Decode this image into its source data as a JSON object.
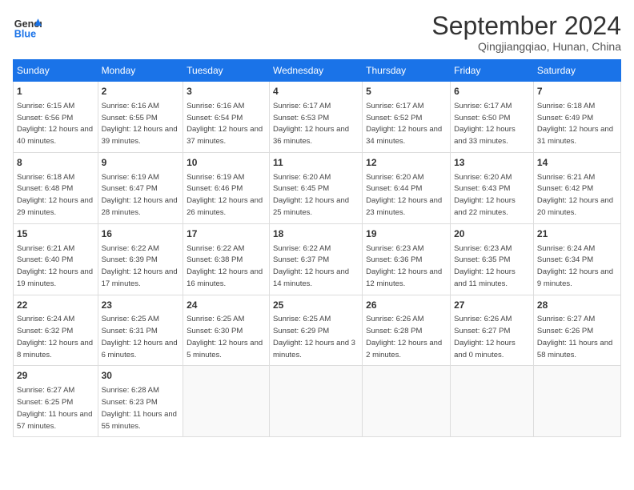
{
  "logo": {
    "line1": "General",
    "line2": "Blue"
  },
  "title": "September 2024",
  "subtitle": "Qingjiangqiao, Hunan, China",
  "days_of_week": [
    "Sunday",
    "Monday",
    "Tuesday",
    "Wednesday",
    "Thursday",
    "Friday",
    "Saturday"
  ],
  "weeks": [
    [
      {
        "day": "1",
        "sunrise": "Sunrise: 6:15 AM",
        "sunset": "Sunset: 6:56 PM",
        "daylight": "Daylight: 12 hours and 40 minutes."
      },
      {
        "day": "2",
        "sunrise": "Sunrise: 6:16 AM",
        "sunset": "Sunset: 6:55 PM",
        "daylight": "Daylight: 12 hours and 39 minutes."
      },
      {
        "day": "3",
        "sunrise": "Sunrise: 6:16 AM",
        "sunset": "Sunset: 6:54 PM",
        "daylight": "Daylight: 12 hours and 37 minutes."
      },
      {
        "day": "4",
        "sunrise": "Sunrise: 6:17 AM",
        "sunset": "Sunset: 6:53 PM",
        "daylight": "Daylight: 12 hours and 36 minutes."
      },
      {
        "day": "5",
        "sunrise": "Sunrise: 6:17 AM",
        "sunset": "Sunset: 6:52 PM",
        "daylight": "Daylight: 12 hours and 34 minutes."
      },
      {
        "day": "6",
        "sunrise": "Sunrise: 6:17 AM",
        "sunset": "Sunset: 6:50 PM",
        "daylight": "Daylight: 12 hours and 33 minutes."
      },
      {
        "day": "7",
        "sunrise": "Sunrise: 6:18 AM",
        "sunset": "Sunset: 6:49 PM",
        "daylight": "Daylight: 12 hours and 31 minutes."
      }
    ],
    [
      {
        "day": "8",
        "sunrise": "Sunrise: 6:18 AM",
        "sunset": "Sunset: 6:48 PM",
        "daylight": "Daylight: 12 hours and 29 minutes."
      },
      {
        "day": "9",
        "sunrise": "Sunrise: 6:19 AM",
        "sunset": "Sunset: 6:47 PM",
        "daylight": "Daylight: 12 hours and 28 minutes."
      },
      {
        "day": "10",
        "sunrise": "Sunrise: 6:19 AM",
        "sunset": "Sunset: 6:46 PM",
        "daylight": "Daylight: 12 hours and 26 minutes."
      },
      {
        "day": "11",
        "sunrise": "Sunrise: 6:20 AM",
        "sunset": "Sunset: 6:45 PM",
        "daylight": "Daylight: 12 hours and 25 minutes."
      },
      {
        "day": "12",
        "sunrise": "Sunrise: 6:20 AM",
        "sunset": "Sunset: 6:44 PM",
        "daylight": "Daylight: 12 hours and 23 minutes."
      },
      {
        "day": "13",
        "sunrise": "Sunrise: 6:20 AM",
        "sunset": "Sunset: 6:43 PM",
        "daylight": "Daylight: 12 hours and 22 minutes."
      },
      {
        "day": "14",
        "sunrise": "Sunrise: 6:21 AM",
        "sunset": "Sunset: 6:42 PM",
        "daylight": "Daylight: 12 hours and 20 minutes."
      }
    ],
    [
      {
        "day": "15",
        "sunrise": "Sunrise: 6:21 AM",
        "sunset": "Sunset: 6:40 PM",
        "daylight": "Daylight: 12 hours and 19 minutes."
      },
      {
        "day": "16",
        "sunrise": "Sunrise: 6:22 AM",
        "sunset": "Sunset: 6:39 PM",
        "daylight": "Daylight: 12 hours and 17 minutes."
      },
      {
        "day": "17",
        "sunrise": "Sunrise: 6:22 AM",
        "sunset": "Sunset: 6:38 PM",
        "daylight": "Daylight: 12 hours and 16 minutes."
      },
      {
        "day": "18",
        "sunrise": "Sunrise: 6:22 AM",
        "sunset": "Sunset: 6:37 PM",
        "daylight": "Daylight: 12 hours and 14 minutes."
      },
      {
        "day": "19",
        "sunrise": "Sunrise: 6:23 AM",
        "sunset": "Sunset: 6:36 PM",
        "daylight": "Daylight: 12 hours and 12 minutes."
      },
      {
        "day": "20",
        "sunrise": "Sunrise: 6:23 AM",
        "sunset": "Sunset: 6:35 PM",
        "daylight": "Daylight: 12 hours and 11 minutes."
      },
      {
        "day": "21",
        "sunrise": "Sunrise: 6:24 AM",
        "sunset": "Sunset: 6:34 PM",
        "daylight": "Daylight: 12 hours and 9 minutes."
      }
    ],
    [
      {
        "day": "22",
        "sunrise": "Sunrise: 6:24 AM",
        "sunset": "Sunset: 6:32 PM",
        "daylight": "Daylight: 12 hours and 8 minutes."
      },
      {
        "day": "23",
        "sunrise": "Sunrise: 6:25 AM",
        "sunset": "Sunset: 6:31 PM",
        "daylight": "Daylight: 12 hours and 6 minutes."
      },
      {
        "day": "24",
        "sunrise": "Sunrise: 6:25 AM",
        "sunset": "Sunset: 6:30 PM",
        "daylight": "Daylight: 12 hours and 5 minutes."
      },
      {
        "day": "25",
        "sunrise": "Sunrise: 6:25 AM",
        "sunset": "Sunset: 6:29 PM",
        "daylight": "Daylight: 12 hours and 3 minutes."
      },
      {
        "day": "26",
        "sunrise": "Sunrise: 6:26 AM",
        "sunset": "Sunset: 6:28 PM",
        "daylight": "Daylight: 12 hours and 2 minutes."
      },
      {
        "day": "27",
        "sunrise": "Sunrise: 6:26 AM",
        "sunset": "Sunset: 6:27 PM",
        "daylight": "Daylight: 12 hours and 0 minutes."
      },
      {
        "day": "28",
        "sunrise": "Sunrise: 6:27 AM",
        "sunset": "Sunset: 6:26 PM",
        "daylight": "Daylight: 11 hours and 58 minutes."
      }
    ],
    [
      {
        "day": "29",
        "sunrise": "Sunrise: 6:27 AM",
        "sunset": "Sunset: 6:25 PM",
        "daylight": "Daylight: 11 hours and 57 minutes."
      },
      {
        "day": "30",
        "sunrise": "Sunrise: 6:28 AM",
        "sunset": "Sunset: 6:23 PM",
        "daylight": "Daylight: 11 hours and 55 minutes."
      },
      null,
      null,
      null,
      null,
      null
    ]
  ]
}
